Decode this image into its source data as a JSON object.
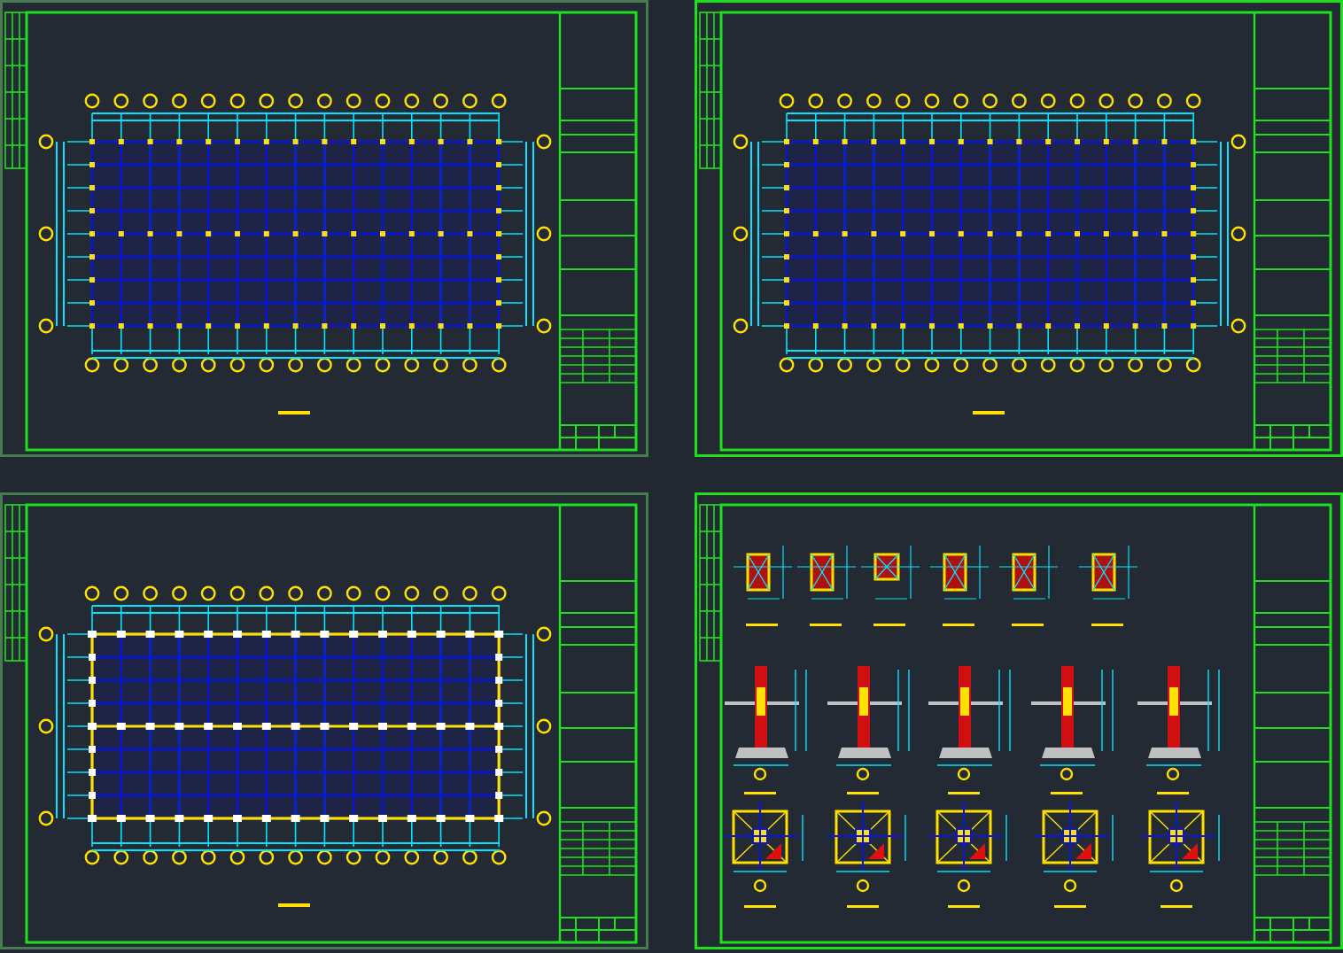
{
  "sheets": [
    {
      "kind": "framing-plan",
      "color": "#4a7a52"
    },
    {
      "kind": "framing-plan",
      "color": "#1fe01f"
    },
    {
      "kind": "foundation-plan",
      "color": "#4a7a52"
    },
    {
      "kind": "details",
      "color": "#1fe01f"
    }
  ]
}
